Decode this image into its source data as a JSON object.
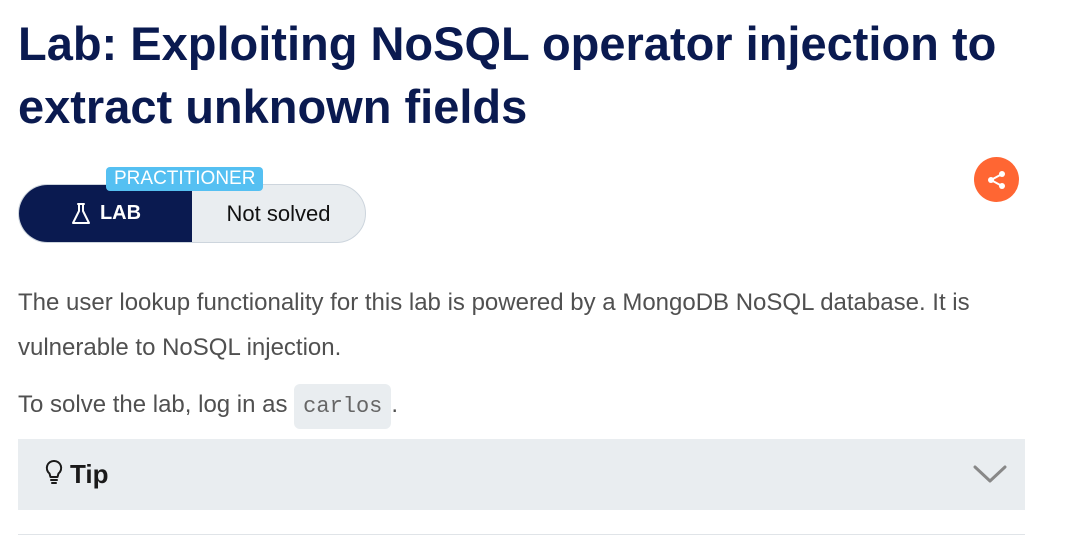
{
  "page": {
    "title": "Lab: Exploiting NoSQL operator injection to extract unknown fields"
  },
  "lab_badge": {
    "level": "PRACTITIONER",
    "type_label": "LAB",
    "type_icon": "flask-icon",
    "status": "Not solved"
  },
  "share": {
    "icon": "share-icon"
  },
  "description": {
    "paragraph": "The user lookup functionality for this lab is powered by a MongoDB NoSQL database. It is vulnerable to NoSQL injection.",
    "solve_prefix": "To solve the lab, log in as ",
    "username": "carlos",
    "solve_suffix": "."
  },
  "tip": {
    "icon": "lightbulb-icon",
    "label": "Tip",
    "toggle_icon": "chevron-down-icon"
  },
  "colors": {
    "title": "#0a1a50",
    "lab_bg": "#0a1a50",
    "badge_bg": "#55c0f2",
    "share_bg": "#ff6633",
    "panel_bg": "#e9edf0",
    "body_text": "#505050"
  }
}
